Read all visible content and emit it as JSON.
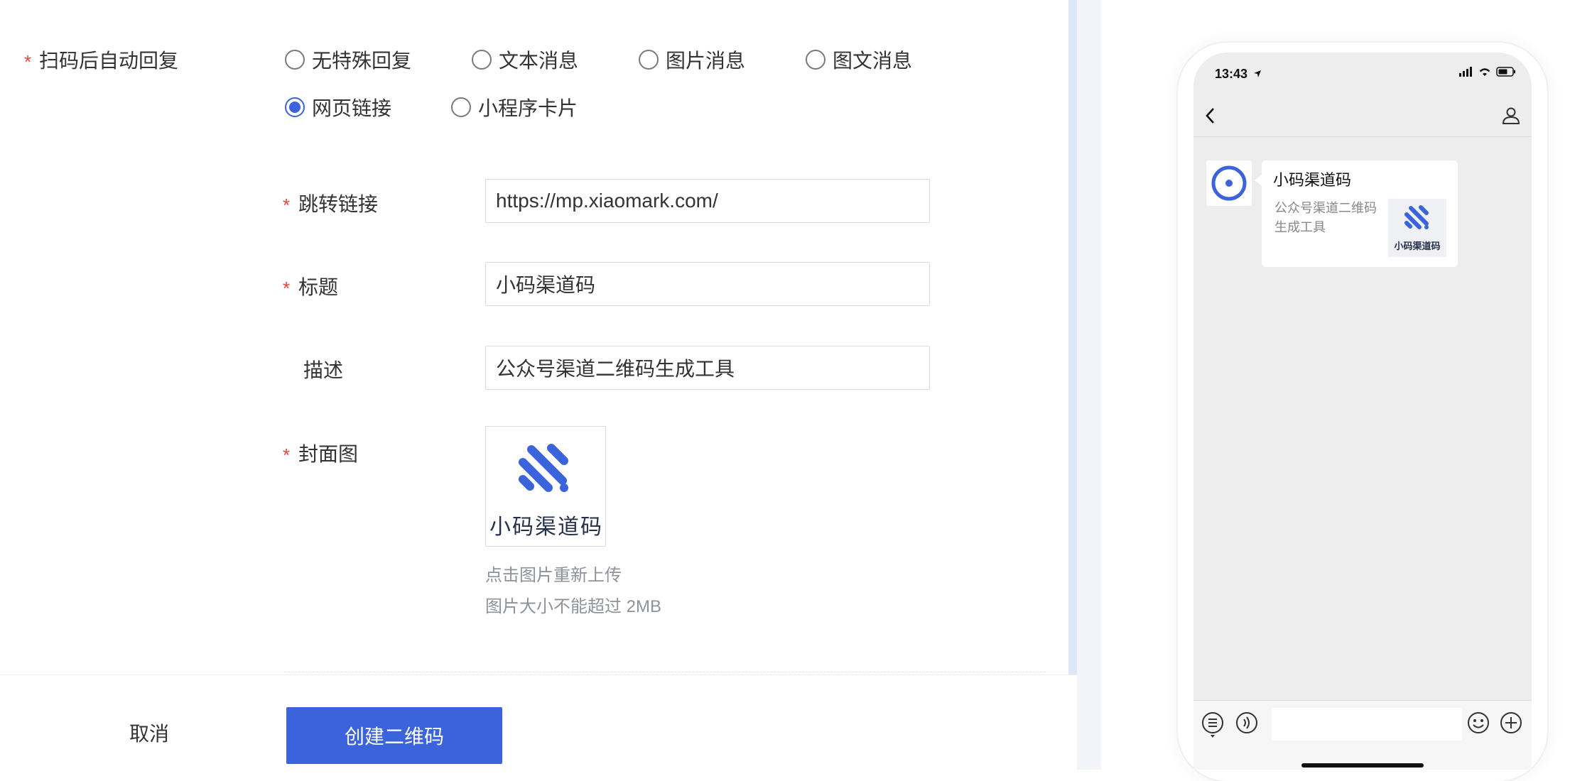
{
  "form": {
    "auto_reply": {
      "label": "扫码后自动回复",
      "options": [
        {
          "label": "无特殊回复",
          "checked": false
        },
        {
          "label": "文本消息",
          "checked": false
        },
        {
          "label": "图片消息",
          "checked": false
        },
        {
          "label": "图文消息",
          "checked": false
        },
        {
          "label": "网页链接",
          "checked": true
        },
        {
          "label": "小程序卡片",
          "checked": false
        }
      ]
    },
    "link": {
      "label": "跳转链接",
      "value": "https://mp.xiaomark.com/"
    },
    "title": {
      "label": "标题",
      "value": "小码渠道码"
    },
    "description": {
      "label": "描述",
      "value": "公众号渠道二维码生成工具"
    },
    "cover": {
      "label": "封面图",
      "image_text": "小码渠道码",
      "hint_reupload": "点击图片重新上传",
      "hint_size": "图片大小不能超过 2MB"
    },
    "required_mark": "*"
  },
  "footer": {
    "cancel_label": "取消",
    "create_label": "创建二维码"
  },
  "preview": {
    "status_time": "13:43",
    "message": {
      "title": "小码渠道码",
      "description": "公众号渠道二维码生成工具",
      "thumb_text": "小码渠道码"
    }
  },
  "colors": {
    "accent": "#3b64dc",
    "required": "#e5483b",
    "hint": "#8e929a"
  },
  "icons": [
    "back-chevron-icon",
    "user-icon",
    "signal-icon",
    "wifi-icon",
    "battery-icon",
    "location-arrow-icon",
    "menu-list-icon",
    "voice-icon",
    "emoji-icon",
    "plus-icon",
    "brand-logo-icon"
  ]
}
